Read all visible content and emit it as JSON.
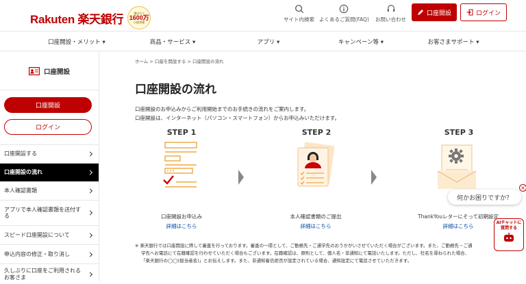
{
  "header": {
    "logo_text": "Rakuten 楽天銀行",
    "seal": {
      "line1": "選ばれて",
      "line2": "1600万",
      "line3": "口座突破"
    },
    "utility": [
      {
        "icon": "search-icon",
        "label": "サイト内検索"
      },
      {
        "icon": "info-icon",
        "label": "よくあるご質問(FAQ)"
      },
      {
        "icon": "headset-icon",
        "label": "お問い合わせ"
      }
    ],
    "open_account_label": "口座開設",
    "login_label": "ログイン"
  },
  "nav": [
    {
      "label": "口座開設・メリット ▾"
    },
    {
      "label": "商品・サービス ▾"
    },
    {
      "label": "アプリ ▾"
    },
    {
      "label": "キャンペーン等 ▾"
    },
    {
      "label": "お客さまサポート ▾"
    }
  ],
  "sidebar": {
    "title": "口座開設",
    "open_button": "口座開設",
    "login_button": "ログイン",
    "items": [
      {
        "label": "口座開設する",
        "active": false
      },
      {
        "label": "口座開設の流れ",
        "active": true
      },
      {
        "label": "本人確認書類",
        "active": false
      },
      {
        "label": "アプリで本人確認書類を送付する",
        "active": false
      },
      {
        "label": "スピード口座開設について",
        "active": false
      },
      {
        "label": "申込内容の修正・取り消し",
        "active": false
      },
      {
        "label": "久しぶりに口座をご利用されるお客さま",
        "active": false
      }
    ]
  },
  "breadcrumb": "ホーム > 口座を開設する > 口座開設の流れ",
  "page_title": "口座開設の流れ",
  "intro": {
    "line1": "口座開設のお申込みからご利用開始までのお手続きの流れをご案内します。",
    "line2": "口座開設は、インターネット（パソコン・スマートフォン）からお申込みいただけます。"
  },
  "steps": [
    {
      "label": "STEP 1",
      "caption": "口座開設お申込み",
      "link": "詳細はこちら",
      "icon": "form-checklist-icon"
    },
    {
      "label": "STEP 2",
      "caption": "本人確認書類のご提出",
      "link": "詳細はこちら",
      "icon": "id-document-icon"
    },
    {
      "label": "STEP 3",
      "caption": "ThankYouレターにそって初期設定",
      "link": "詳細はこちら",
      "icon": "letter-gear-icon"
    }
  ],
  "note": {
    "line1": "※ 楽天銀行では口座開設に際して審査を行っております。審査の一環として、ご勤務先・ご通学先のおうかがいさせていただく場合がございます。また、ご勤務先・ご通",
    "line2": "学先へお電話にて在籍確認を行わせていただく場合もございます。在籍確認は、原則として、個人名・非通知にて電話いたします。ただし、社名を尋ねられた場合、",
    "line3": "「楽天銀行の◯◯(担当者名)」とお伝えします。また、非通知着信拒否が設定されている場合、通知設定にて電話させていただきます。"
  },
  "chat": {
    "bubble": "何かお困りですか？",
    "close": "×",
    "bot_line1": "AIチャットに",
    "bot_line2": "質問する"
  },
  "colors": {
    "brand": "#bf0000",
    "link": "#0047a0",
    "active_bg": "#000000"
  }
}
